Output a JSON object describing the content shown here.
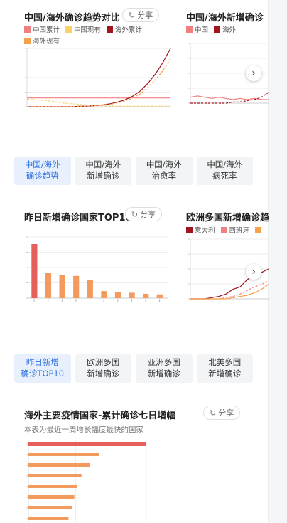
{
  "card1": {
    "title": "中国/海外确诊趋势对比",
    "share_label": "分享",
    "legend": [
      {
        "label": "中国累计",
        "color": "#f08080"
      },
      {
        "label": "中国现有",
        "color": "#f7d26a"
      },
      {
        "label": "海外累计",
        "color": "#a3141c"
      },
      {
        "label": "海外现有",
        "color": "#f4a24c"
      }
    ]
  },
  "card2": {
    "title": "中国/海外新增确诊",
    "legend": [
      {
        "label": "中国",
        "color": "#f08080"
      },
      {
        "label": "海外",
        "color": "#a3141c"
      }
    ]
  },
  "tabs1": [
    {
      "line1": "中国/海外",
      "line2": "确诊趋势",
      "active": true
    },
    {
      "line1": "中国/海外",
      "line2": "新增确诊",
      "active": false
    },
    {
      "line1": "中国/海外",
      "line2": "治愈率",
      "active": false
    },
    {
      "line1": "中国/海外",
      "line2": "病死率",
      "active": false
    }
  ],
  "card3": {
    "title": "昨日新增确诊国家TOP10",
    "share_label": "分享"
  },
  "card4": {
    "title": "欧洲多国新增确诊趋势",
    "legend": [
      {
        "label": "意大利",
        "color": "#a3141c"
      },
      {
        "label": "西班牙",
        "color": "#f08080"
      },
      {
        "label": "",
        "color": "#f4a24c"
      }
    ]
  },
  "tabs2": [
    {
      "line1": "昨日新增",
      "line2": "确诊TOP10",
      "active": true
    },
    {
      "line1": "欧洲多国",
      "line2": "新增确诊",
      "active": false
    },
    {
      "line1": "亚洲多国",
      "line2": "新增确诊",
      "active": false
    },
    {
      "line1": "北美多国",
      "line2": "新增确诊",
      "active": false
    }
  ],
  "card5": {
    "title": "海外主要疫情国家-累计确诊七日增幅",
    "share_label": "分享",
    "subtitle": "本表为最近一周增长幅度最快的国家"
  },
  "chart_data": [
    {
      "type": "line",
      "title": "中国/海外确诊趋势对比",
      "x": [
        1,
        2,
        3,
        4,
        5,
        6,
        7,
        8,
        9,
        10,
        11,
        12,
        13,
        14,
        15,
        16,
        17,
        18,
        19,
        20
      ],
      "series": [
        {
          "name": "中国累计",
          "values": [
            0.15,
            0.15,
            0.15,
            0.15,
            0.15,
            0.15,
            0.15,
            0.15,
            0.15,
            0.15,
            0.15,
            0.15,
            0.15,
            0.15,
            0.15,
            0.15,
            0.15,
            0.15,
            0.15,
            0.15
          ]
        },
        {
          "name": "中国现有",
          "values": [
            0.13,
            0.12,
            0.11,
            0.1,
            0.08,
            0.06,
            0.05,
            0.04,
            0.03,
            0.02,
            0.02,
            0.01,
            0.01,
            0.01,
            0.01,
            0.01,
            0.01,
            0.01,
            0.01,
            0.01
          ]
        },
        {
          "name": "海外累计",
          "values": [
            0,
            0,
            0,
            0,
            0,
            0,
            0,
            0.01,
            0.01,
            0.02,
            0.03,
            0.05,
            0.08,
            0.12,
            0.18,
            0.27,
            0.4,
            0.56,
            0.76,
            1.0
          ]
        },
        {
          "name": "海外现有",
          "values": [
            0,
            0,
            0,
            0,
            0,
            0,
            0,
            0.01,
            0.01,
            0.02,
            0.03,
            0.04,
            0.07,
            0.1,
            0.15,
            0.22,
            0.33,
            0.46,
            0.62,
            0.82
          ]
        }
      ]
    },
    {
      "type": "line",
      "title": "中国/海外新增确诊",
      "x": [
        1,
        2,
        3,
        4,
        5,
        6,
        7,
        8,
        9,
        10,
        11,
        12
      ],
      "series": [
        {
          "name": "中国",
          "values": [
            0.05,
            0.06,
            0.05,
            0.04,
            0.05,
            0.04,
            0.03,
            0.04,
            0.03,
            0.04,
            0.03,
            0.03
          ]
        },
        {
          "name": "海外",
          "values": [
            0,
            0,
            0,
            0,
            0,
            0,
            0.01,
            0.01,
            0.02,
            0.03,
            0.05,
            0.09
          ]
        }
      ]
    },
    {
      "type": "bar",
      "title": "昨日新增确诊国家TOP10",
      "categories": [
        "",
        "",
        "",
        "",
        "",
        "",
        "",
        "",
        "",
        ""
      ],
      "values": [
        1.0,
        0.46,
        0.43,
        0.41,
        0.34,
        0.13,
        0.11,
        0.1,
        0.08,
        0.07
      ]
    },
    {
      "type": "line",
      "title": "欧洲多国新增确诊趋势",
      "x": [
        1,
        2,
        3,
        4,
        5,
        6,
        7,
        8,
        9,
        10,
        11,
        12
      ],
      "series": [
        {
          "name": "意大利",
          "values": [
            0,
            0,
            0,
            0.01,
            0.02,
            0.04,
            0.08,
            0.1,
            0.16,
            0.2,
            0.22,
            0.25
          ]
        },
        {
          "name": "西班牙",
          "values": [
            0,
            0,
            0,
            0,
            0,
            0.01,
            0.02,
            0.04,
            0.07,
            0.1,
            0.12,
            0.15
          ]
        },
        {
          "name": "",
          "values": [
            0,
            0,
            0,
            0,
            0,
            0,
            0.01,
            0.02,
            0.03,
            0.05,
            0.08,
            0.12
          ]
        }
      ]
    },
    {
      "type": "bar",
      "title": "海外主要疫情国家-累计确诊七日增幅",
      "categories": [
        "",
        "",
        "",
        "",
        "",
        "",
        "",
        ""
      ],
      "values": [
        1.0,
        0.6,
        0.52,
        0.45,
        0.41,
        0.39,
        0.37,
        0.34
      ]
    }
  ]
}
